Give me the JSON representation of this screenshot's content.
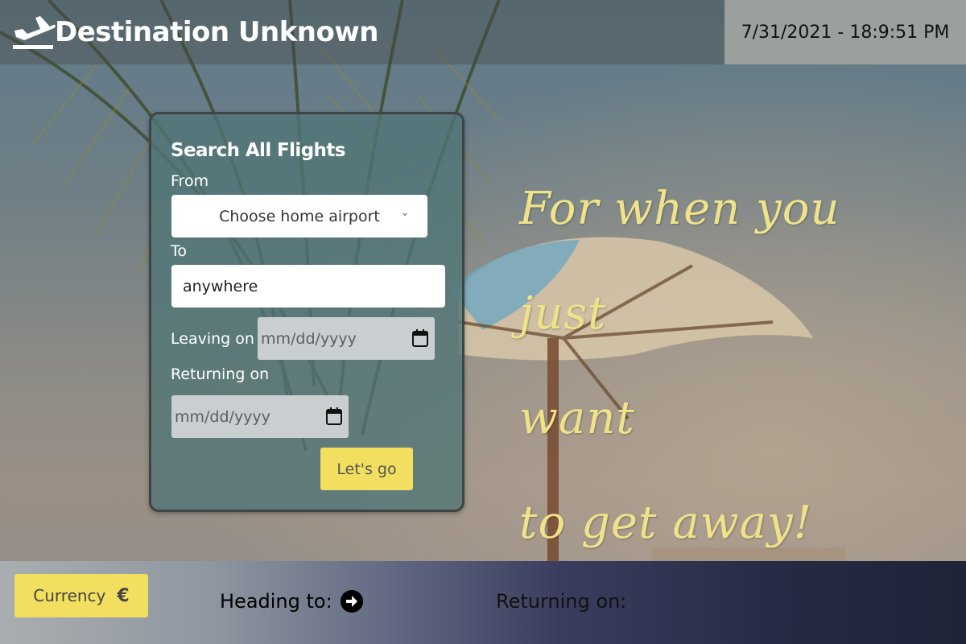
{
  "header": {
    "logo_text": "Destination Unknown",
    "datetime": "7/31/2021 - 18:9:51 PM"
  },
  "search": {
    "title": "Search All Flights",
    "from_label": "From",
    "from_placeholder": "Choose home airport",
    "to_label": "To",
    "to_value": "anywhere",
    "leaving_label": "Leaving on",
    "leaving_placeholder": "mm/dd/yyyy",
    "returning_label": "Returning on",
    "returning_placeholder": "mm/dd/yyyy",
    "submit_label": "Let's go"
  },
  "tagline": {
    "line1": "For when you just",
    "line2": "want",
    "line3": "to get away!"
  },
  "footer": {
    "currency_label": "Currency",
    "currency_symbol": "€",
    "heading_to_label": "Heading to:",
    "returning_on_label": "Returning on:"
  },
  "icons": {
    "logo": "airplane-takeoff-icon",
    "select_chevron": "chevron-down-icon",
    "calendar": "calendar-icon",
    "heading_arrow": "arrow-right-circle-icon"
  },
  "colors": {
    "accent_yellow": "#f2df5f",
    "tagline_yellow": "#efe38a",
    "card_bg": "#507476"
  }
}
